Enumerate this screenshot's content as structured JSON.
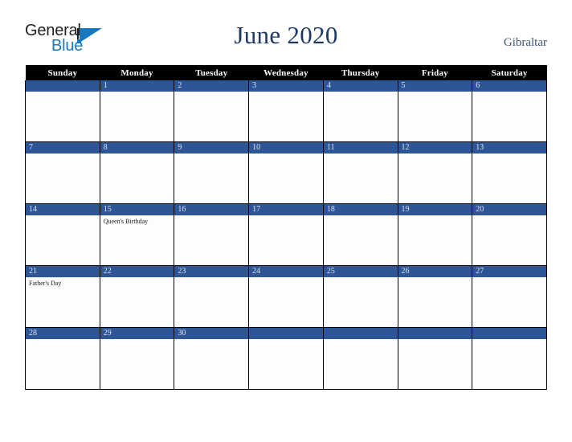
{
  "brand": {
    "word_one": "General",
    "word_two": "Blue",
    "mark": "triangle-flag-logo",
    "color_dark": "#231f20",
    "color_blue": "#1878be"
  },
  "header": {
    "title": "June 2020",
    "region": "Gibraltar",
    "title_color": "#1f3864",
    "region_color": "#3f5577"
  },
  "calendar": {
    "accent_color": "#2e5596",
    "header_bg": "#000000",
    "header_fg": "#ffffff",
    "weekdays": [
      "Sunday",
      "Monday",
      "Tuesday",
      "Wednesday",
      "Thursday",
      "Friday",
      "Saturday"
    ],
    "weeks": [
      [
        {
          "day": "",
          "events": []
        },
        {
          "day": "1",
          "events": []
        },
        {
          "day": "2",
          "events": []
        },
        {
          "day": "3",
          "events": []
        },
        {
          "day": "4",
          "events": []
        },
        {
          "day": "5",
          "events": []
        },
        {
          "day": "6",
          "events": []
        }
      ],
      [
        {
          "day": "7",
          "events": []
        },
        {
          "day": "8",
          "events": []
        },
        {
          "day": "9",
          "events": []
        },
        {
          "day": "10",
          "events": []
        },
        {
          "day": "11",
          "events": []
        },
        {
          "day": "12",
          "events": []
        },
        {
          "day": "13",
          "events": []
        }
      ],
      [
        {
          "day": "14",
          "events": []
        },
        {
          "day": "15",
          "events": [
            "Queen's Birthday"
          ]
        },
        {
          "day": "16",
          "events": []
        },
        {
          "day": "17",
          "events": []
        },
        {
          "day": "18",
          "events": []
        },
        {
          "day": "19",
          "events": []
        },
        {
          "day": "20",
          "events": []
        }
      ],
      [
        {
          "day": "21",
          "events": [
            "Father's Day"
          ]
        },
        {
          "day": "22",
          "events": []
        },
        {
          "day": "23",
          "events": []
        },
        {
          "day": "24",
          "events": []
        },
        {
          "day": "25",
          "events": []
        },
        {
          "day": "26",
          "events": []
        },
        {
          "day": "27",
          "events": []
        }
      ],
      [
        {
          "day": "28",
          "events": []
        },
        {
          "day": "29",
          "events": []
        },
        {
          "day": "30",
          "events": []
        },
        {
          "day": "",
          "events": []
        },
        {
          "day": "",
          "events": []
        },
        {
          "day": "",
          "events": []
        },
        {
          "day": "",
          "events": []
        }
      ]
    ]
  }
}
